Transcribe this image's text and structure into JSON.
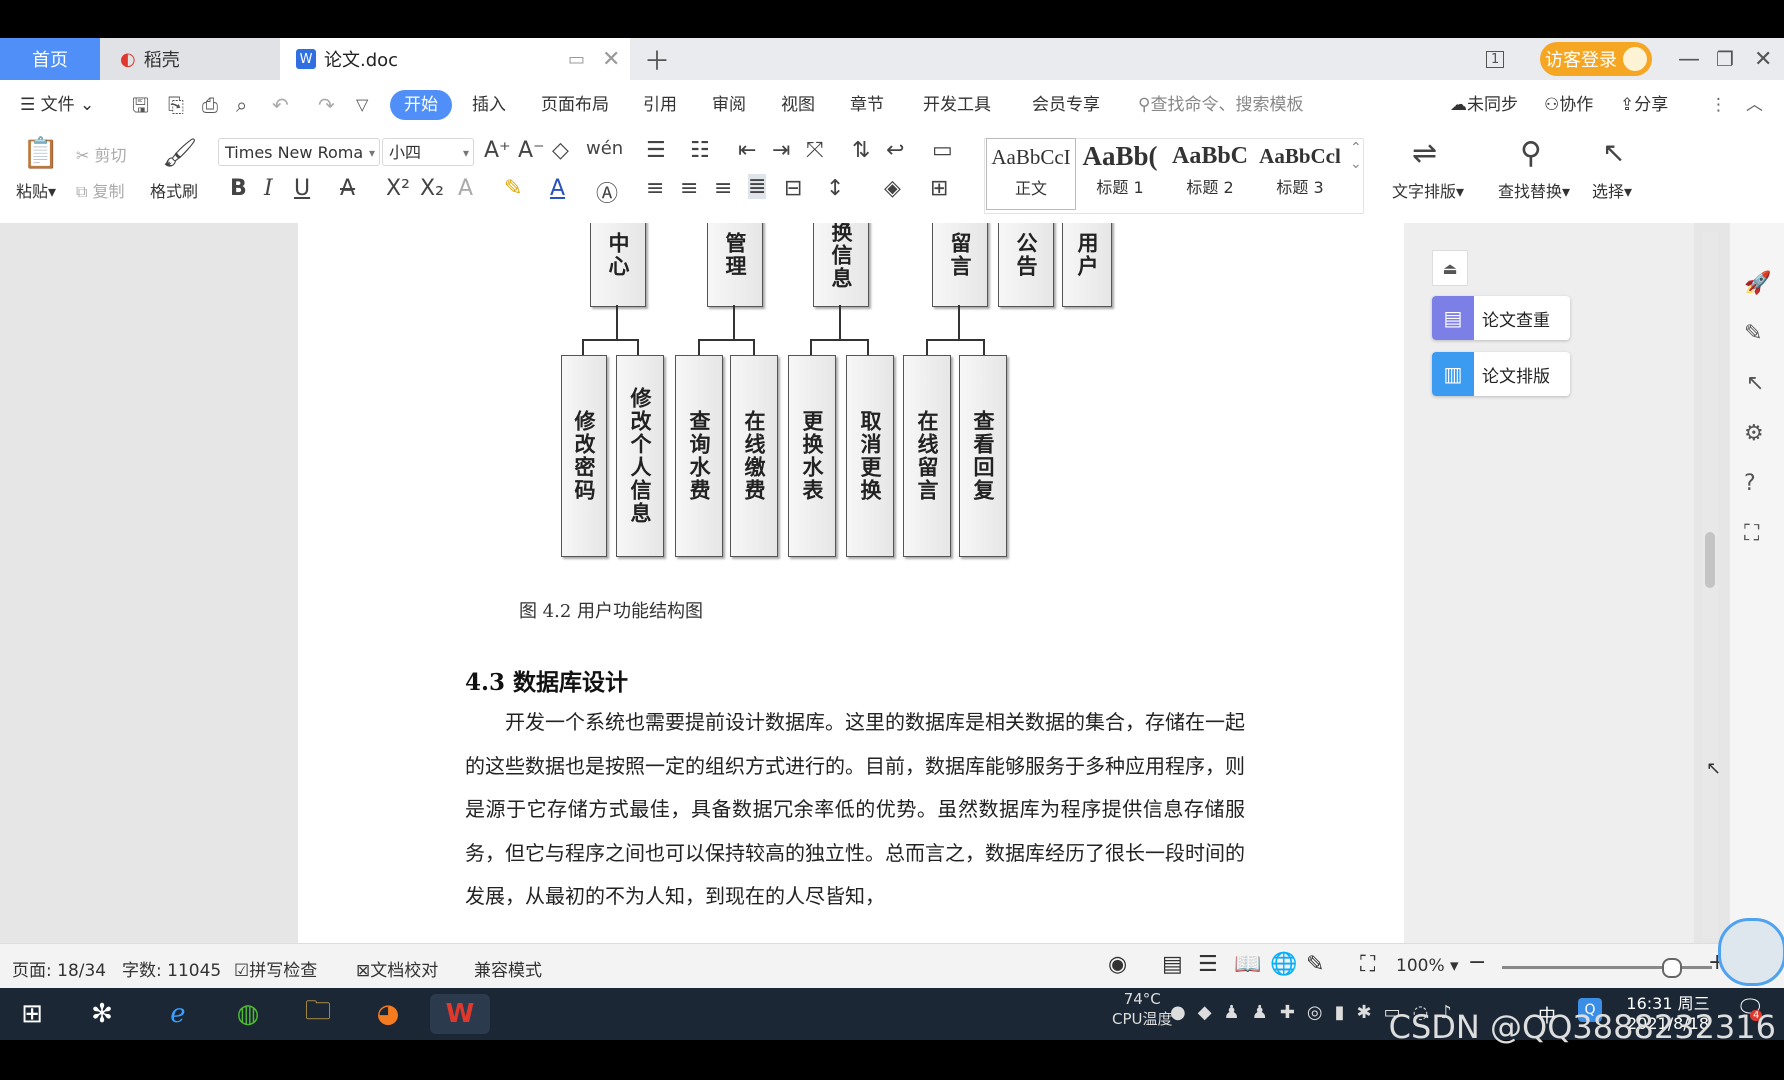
{
  "tabs": {
    "home": "首页",
    "daoke": "稻壳",
    "doc": "论文.doc"
  },
  "window": {
    "login_label": "访客登录",
    "page_indicator": "1"
  },
  "menu": {
    "file": "文件",
    "items": [
      "开始",
      "插入",
      "页面布局",
      "引用",
      "审阅",
      "视图",
      "章节",
      "开发工具",
      "会员专享"
    ],
    "search_placeholder": "查找命令、搜索模板",
    "sync": "未同步",
    "collab": "协作",
    "share": "分享"
  },
  "ribbon": {
    "paste": "粘贴",
    "cut": "剪切",
    "copy": "复制",
    "format_painter": "格式刷",
    "font_name": "Times New Roma",
    "font_size": "小四",
    "styles": [
      {
        "preview": "AaBbCcI",
        "name": "正文"
      },
      {
        "preview": "AaBb(",
        "name": "标题 1"
      },
      {
        "preview": "AaBbC",
        "name": "标题 2"
      },
      {
        "preview": "AaBbCcl",
        "name": "标题 3"
      }
    ],
    "text_layout": "文字排版",
    "find_replace": "查找替换",
    "select": "选择"
  },
  "diagram": {
    "top_boxes": [
      "中心",
      "管理",
      "换信息",
      "留言",
      "公告",
      "用户"
    ],
    "leaf_boxes": [
      "修改密码",
      "修改个人信息",
      "查询水费",
      "在线缴费",
      "更换水表",
      "取消更换",
      "在线留言",
      "查看回复"
    ],
    "caption": "图 4.2  用户功能结构图"
  },
  "document": {
    "section_title": "4.3  数据库设计",
    "paragraph": "开发一个系统也需要提前设计数据库。这里的数据库是相关数据的集合，存储在一起的这些数据也是按照一定的组织方式进行的。目前，数据库能够服务于多种应用程序，则是源于它存储方式最佳，具备数据冗余率低的优势。虽然数据库为程序提供信息存储服务，但它与程序之间也可以保持较高的独立性。总而言之，数据库经历了很长一段时间的发展，从最初的不为人知，到现在的人尽皆知，"
  },
  "side_panel": {
    "check": "论文查重",
    "layout": "论文排版"
  },
  "status": {
    "page": "页面: 18/34",
    "words": "字数: 11045",
    "spell": "拼写检查",
    "proof": "文档校对",
    "compat": "兼容模式",
    "zoom": "100%",
    "zoom_level": 0.8
  },
  "taskbar": {
    "temp": "74°C",
    "cpu": "CPU温度",
    "ime": "中",
    "time": "16:31 周三",
    "date": "2021/8/18",
    "notify_count": "4"
  },
  "watermark": "CSDN @QQ3888232316",
  "colors": {
    "accent": "#4f8ff7",
    "login": "#f5a623",
    "taskbar": "#1b2735"
  }
}
